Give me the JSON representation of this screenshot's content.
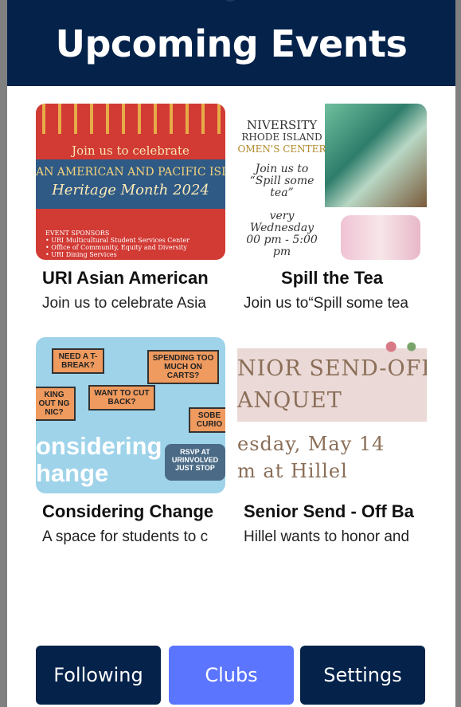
{
  "header": {
    "title": "Upcoming Events"
  },
  "events": [
    {
      "title": "URI Asian American",
      "desc": "Join us to celebrate Asia",
      "image": {
        "line1": "Join us to celebrate",
        "band_a": "AN AMERICAN AND PACIFIC ISLA",
        "band_b": "Heritage Month 2024",
        "sponsors": [
          "EVENT SPONSORS",
          "• URI Multicultural Student Services Center",
          "• Office of Community, Equity and Diversity",
          "• URI Dining Services"
        ]
      }
    },
    {
      "title": "Spill the Tea",
      "desc": "Join us to“Spill some tea",
      "image": {
        "lines": [
          "NIVERSITY",
          "RHODE ISLAND",
          "OMEN'S CENTER",
          "Join us to",
          "“Spill some tea”",
          "very Wednesday",
          "00 pm - 5:00 pm"
        ]
      }
    },
    {
      "title": "Considering Change",
      "desc": "A space for students to c",
      "image": {
        "notes": [
          "NEED A T-BREAK?",
          "SPENDING TOO MUCH ON CARTS?",
          "WANT TO CUT BACK?",
          "KING OUT NG NIC?",
          "SOBE CURIO"
        ],
        "big1": "onsidering",
        "big2": "hange",
        "rsvp": "RSVP AT URINVOLVED JUST STOP"
      }
    },
    {
      "title": "Senior Send - Off Ba",
      "desc": "Hillel wants to honor and",
      "image": {
        "l1": "NIOR SEND-OFF",
        "l2": "ANQUET",
        "l3": "esday, May 14",
        "l4": "m at Hillel"
      }
    }
  ],
  "nav": {
    "following": "Following",
    "clubs": "Clubs",
    "settings": "Settings",
    "colors": {
      "dark": "#04224a",
      "active": "#5b75ff"
    }
  }
}
